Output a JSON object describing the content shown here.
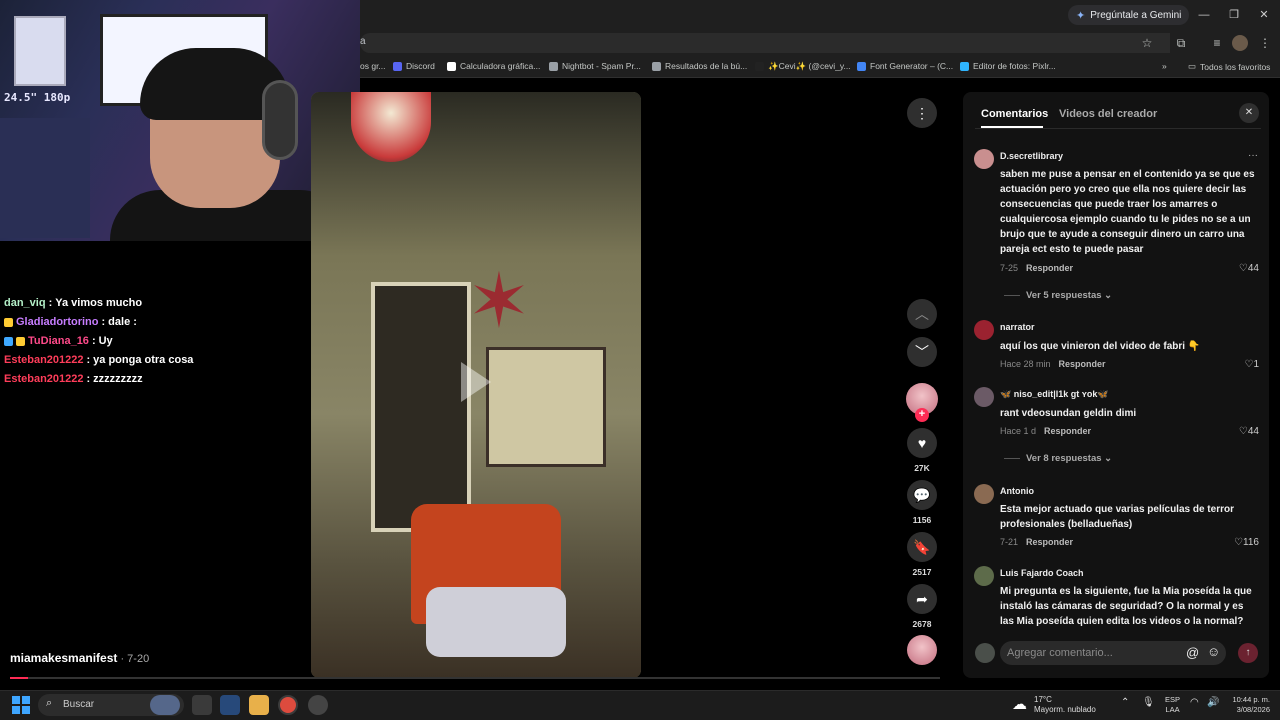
{
  "browser": {
    "gemini_button": "Pregúntale a Gemini",
    "omnibox_text": "a",
    "bookmarks": [
      {
        "label": "os gr...",
        "color": "#9aa0a6"
      },
      {
        "label": "Discord",
        "color": "#5865f2"
      },
      {
        "label": "Calculadora gráfica...",
        "color": "#ffffff"
      },
      {
        "label": "Nightbot - Spam Pr...",
        "color": "#9aa0a6"
      },
      {
        "label": "Resultados de la bú...",
        "color": "#9aa0a6"
      },
      {
        "label": "✨Cevi✨ (@cevi_y...",
        "color": "#222222"
      },
      {
        "label": "Font Generator – (C...",
        "color": "#4285f4"
      },
      {
        "label": "Editor de fotos: Pixlr...",
        "color": "#2fb5ff"
      }
    ],
    "all_bookmarks": "Todos los favoritos"
  },
  "webcam": {
    "overlay_label": "24.5\" 180p"
  },
  "chat": [
    {
      "user": "dan_viq",
      "message": "Ya vimos mucho",
      "color": "#b4f0c8",
      "badges": []
    },
    {
      "user": "Gladiadortorino",
      "message": "dale :",
      "color": "#c77dff",
      "badges": [
        "#ffcc33"
      ]
    },
    {
      "user": "TuDiana_16",
      "message": "Uy",
      "color": "#ff4a8a",
      "badges": [
        "#3fa9ff",
        "#ffcc33"
      ]
    },
    {
      "user": "Esteban201222",
      "message": "ya ponga otra cosa",
      "color": "#ff3d5a",
      "badges": []
    },
    {
      "user": "Esteban201222",
      "message": "zzzzzzzzz",
      "color": "#ff3d5a",
      "badges": []
    }
  ],
  "video": {
    "author": "miamakesmanifest",
    "date": " · 7-20"
  },
  "actions": {
    "likes": "27K",
    "comments": "1156",
    "saves": "2517",
    "shares": "2678"
  },
  "panel": {
    "tab_comments": "Comentarios",
    "tab_creator": "Videos del creador",
    "comments": [
      {
        "user": "D.secretlibrary",
        "text": "saben me puse a pensar en el contenido ya se que es actuación pero yo creo que ella nos quiere decir las consecuencias que puede traer los amarres o cualquiercosa ejemplo cuando tu le pides no se a un brujo que te ayude a conseguir dinero un carro una pareja ect esto te puede pasar",
        "date": "7-25",
        "reply": "Responder",
        "likes": "44",
        "replies": "Ver 5 respuestas",
        "avatar": "#c98f8f"
      },
      {
        "user": "narrator",
        "text": "aquí los que vinieron del video de fabri 👇",
        "date": "Hace 28 min",
        "reply": "Responder",
        "likes": "1",
        "replies": "",
        "avatar": "#9b2230"
      },
      {
        "user": "🦋 niso_edit|l1k gt ʏok🦋",
        "text": "rant vdeosundan geldin dimi",
        "date": "Hace 1 d",
        "reply": "Responder",
        "likes": "44",
        "replies": "Ver 8 respuestas",
        "avatar": "#6b5a66"
      },
      {
        "user": "Antonio",
        "text": "Esta mejor actuado que varias películas de terror profesionales (belladueñas)",
        "date": "7-21",
        "reply": "Responder",
        "likes": "116",
        "replies": "",
        "avatar": "#8a6a52"
      },
      {
        "user": "Luis Fajardo Coach",
        "text": "Mi pregunta es la siguiente, fue la Mia poseída la que instaló las cámaras de seguridad? O la normal y es las Mia poseída quien edita los videos o la normal?",
        "date": "",
        "reply": "",
        "likes": "",
        "replies": "",
        "avatar": "#5d6b4a"
      }
    ],
    "input_placeholder": "Agregar comentario..."
  },
  "taskbar": {
    "search": "Buscar",
    "weather_temp": "17°C",
    "weather_desc": "Mayorm. nublado",
    "lang_1": "ESP",
    "lang_2": "LAA",
    "time": "10:44 p. m.",
    "date": "3/08/2026"
  }
}
